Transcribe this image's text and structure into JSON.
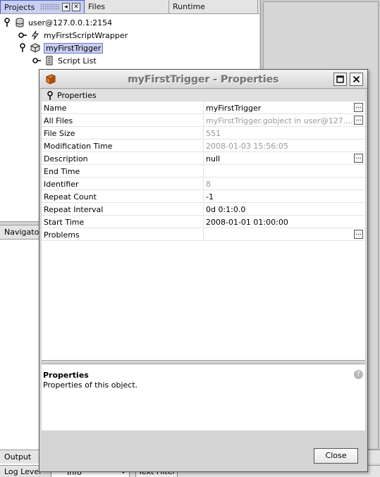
{
  "ide": {
    "tabs": [
      {
        "label": "Projects"
      },
      {
        "label": "Files"
      },
      {
        "label": "Runtime"
      }
    ],
    "tree": {
      "connection": "user@127.0.0.1:2154",
      "script_wrapper": "myFirstScriptWrapper",
      "trigger": "myFirstTrigger",
      "script_list": "Script List"
    },
    "navigator_label": "Navigator",
    "output_label": "Output",
    "log_level_label": "Log Level",
    "log_level_value": "Info",
    "text_filter_label": "Text Filter"
  },
  "dialog": {
    "title": "myFirstTrigger - Properties",
    "section_label": "Properties",
    "properties": [
      {
        "name": "Name",
        "value": "myFirstTrigger",
        "editable": true
      },
      {
        "name": "All Files",
        "value": "myFirstTrigger.gobject in user@127....",
        "editable": false
      },
      {
        "name": "File Size",
        "value": "551",
        "editable": false
      },
      {
        "name": "Modification Time",
        "value": "2008-01-03 15:56:05",
        "editable": false
      },
      {
        "name": "Description",
        "value": "null",
        "editable": true
      },
      {
        "name": "End Time",
        "value": "",
        "editable": true
      },
      {
        "name": "Identifier",
        "value": "8",
        "editable": false
      },
      {
        "name": "Repeat Count",
        "value": "-1",
        "editable": true
      },
      {
        "name": "Repeat Interval",
        "value": "0d 0:1:0.0",
        "editable": true
      },
      {
        "name": "Start Time",
        "value": "2008-01-01 01:00:00",
        "editable": true
      },
      {
        "name": "Problems",
        "value": "",
        "editable": true
      }
    ],
    "description": {
      "title": "Properties",
      "text": "Properties of this object."
    },
    "close_label": "Close"
  }
}
